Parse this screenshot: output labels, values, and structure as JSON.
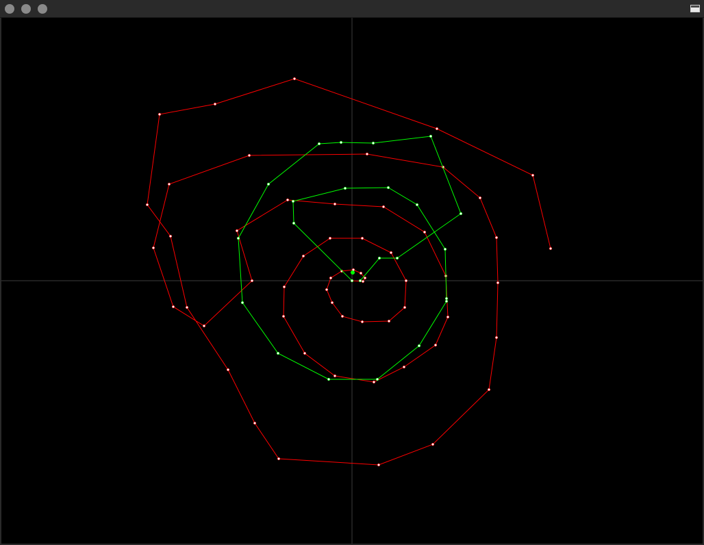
{
  "window": {
    "controls": [
      "close",
      "minimize",
      "maximize"
    ],
    "restore_icon": "window-restore-icon"
  },
  "plot": {
    "background": "#000000",
    "axis_color": "#3c3c3c",
    "red_color": "#ff0000",
    "green_color": "#00ff00",
    "marker_fill": "#ffffff",
    "red_polyline": [
      [
        0.0,
        0.0
      ],
      [
        16,
        1
      ],
      [
        19,
        -4
      ],
      [
        13,
        -11
      ],
      [
        2,
        -16
      ],
      [
        -15,
        -14
      ],
      [
        -31,
        -4
      ],
      [
        -37,
        13
      ],
      [
        -29,
        32
      ],
      [
        -14,
        52
      ],
      [
        15,
        60
      ],
      [
        54,
        59
      ],
      [
        77,
        39
      ],
      [
        79,
        0
      ],
      [
        57,
        -41
      ],
      [
        15,
        -62
      ],
      [
        -32,
        -62
      ],
      [
        -71,
        -36
      ],
      [
        -99,
        9
      ],
      [
        -100,
        52
      ],
      [
        -69,
        106
      ],
      [
        -25,
        139
      ],
      [
        32,
        148
      ],
      [
        76,
        126
      ],
      [
        122,
        94
      ],
      [
        140,
        53
      ],
      [
        137,
        -7
      ],
      [
        106,
        -71
      ],
      [
        46,
        -108
      ],
      [
        -25,
        -112
      ],
      [
        -94,
        -118
      ],
      [
        -168,
        -73
      ],
      [
        -146,
        0
      ],
      [
        -216,
        66
      ],
      [
        -261,
        38
      ],
      [
        -290,
        -48
      ],
      [
        -267,
        -141
      ],
      [
        -150,
        -183
      ],
      [
        22,
        -185
      ],
      [
        133,
        -166
      ],
      [
        187,
        -121
      ],
      [
        211,
        -63
      ],
      [
        213,
        3
      ],
      [
        211,
        83
      ],
      [
        200,
        159
      ],
      [
        118,
        239
      ],
      [
        39,
        269
      ],
      [
        -107,
        260
      ],
      [
        -142,
        208
      ],
      [
        -181,
        130
      ],
      [
        -241,
        39
      ],
      [
        -265,
        -65
      ],
      [
        -299,
        -111
      ],
      [
        -281,
        -243
      ],
      [
        -200,
        -258
      ],
      [
        -84,
        -295
      ],
      [
        124,
        -222
      ],
      [
        264,
        -154
      ],
      [
        290,
        -47
      ]
    ],
    "green_polyline": [
      [
        0.0,
        0.0
      ],
      [
        -85,
        -84
      ],
      [
        -86,
        -116
      ],
      [
        -10,
        -135
      ],
      [
        53,
        -136
      ],
      [
        95,
        -111
      ],
      [
        136,
        -46
      ],
      [
        138,
        26
      ],
      [
        138,
        30
      ],
      [
        98,
        95
      ],
      [
        37,
        144
      ],
      [
        -34,
        144
      ],
      [
        -108,
        106
      ],
      [
        -160,
        32
      ],
      [
        -166,
        -62
      ],
      [
        -122,
        -141
      ],
      [
        -48,
        -200
      ],
      [
        -16,
        -202
      ],
      [
        31,
        -201
      ],
      [
        115,
        -211
      ],
      [
        159,
        -98
      ],
      [
        66,
        -33
      ],
      [
        40,
        -33
      ],
      [
        12,
        0
      ]
    ]
  }
}
